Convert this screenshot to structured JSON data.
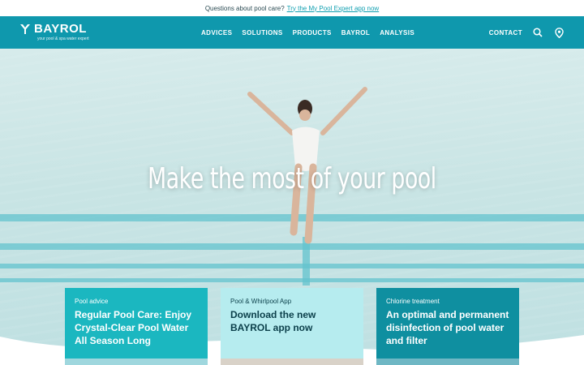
{
  "topbar": {
    "question": "Questions about pool care?",
    "link": "Try the My Pool Expert app now"
  },
  "header": {
    "brand": "BAYROL",
    "tagline": "your pool & spa water expert",
    "menu": [
      "ADVICES",
      "SOLUTIONS",
      "PRODUCTS",
      "BAYROL",
      "ANALYSIS"
    ],
    "contact": "CONTACT",
    "icons": [
      "search-icon",
      "location-pin-icon"
    ]
  },
  "hero": {
    "title": "Make the most of your pool"
  },
  "cards": [
    {
      "category": "Pool advice",
      "title": "Regular Pool Care: Enjoy Crystal-Clear Pool Water All Season Long"
    },
    {
      "category": "Pool & Whirlpool App",
      "title": "Download the new BAYROL app now"
    },
    {
      "category": "Chlorine treatment",
      "title": "An optimal and permanent disinfection of pool water and filter"
    }
  ],
  "colors": {
    "nav": "#0f98ad",
    "card1": "#1bb7c0",
    "card2": "#b6ecef",
    "card3": "#0f8fa0",
    "link": "#0f9fb0"
  }
}
